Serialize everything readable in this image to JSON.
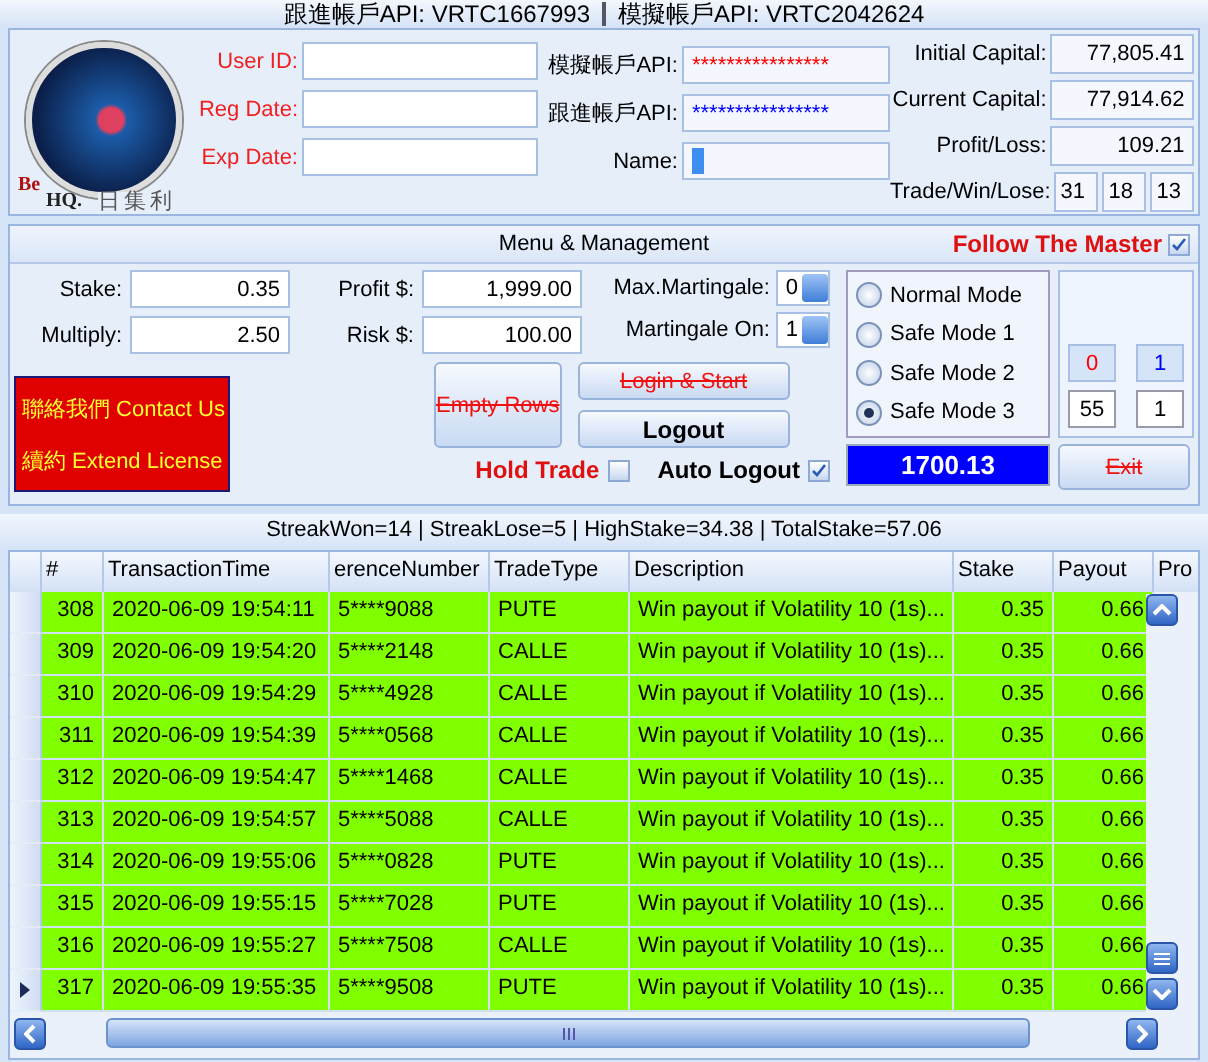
{
  "header": {
    "follow_api": "跟進帳戶API: VRTC1667993",
    "demo_api": "模擬帳戶API: VRTC2042624"
  },
  "logo": {
    "text_1": "Be",
    "text_2": "HQ.",
    "text_3": "日集利"
  },
  "account_fields": [
    {
      "label": "User ID:"
    },
    {
      "label": "Reg Date:"
    },
    {
      "label": "Exp Date:"
    }
  ],
  "api_fields": [
    {
      "label": "模擬帳戶API:",
      "value": "****************",
      "color": "#ff0000"
    },
    {
      "label": "跟進帳戶API:",
      "value": "****************",
      "color": "#0000ff"
    },
    {
      "label": "Name:"
    }
  ],
  "capital": [
    {
      "label": "Initial Capital:",
      "value": "77,805.41"
    },
    {
      "label": "Current Capital:",
      "value": "77,914.62"
    },
    {
      "label": "Profit/Loss:",
      "value": "109.21"
    }
  ],
  "trade_win_lose": {
    "label": "Trade/Win/Lose:",
    "values": [
      "31",
      "18",
      "13"
    ]
  },
  "menu": {
    "title": "Menu & Management",
    "follow": {
      "label": "Follow The Master",
      "checked": true
    }
  },
  "stake": {
    "label": "Stake:",
    "value": "0.35"
  },
  "multiply": {
    "label": "Multiply:",
    "value": "2.50"
  },
  "profit": {
    "label": "Profit $:",
    "value": "1,999.00"
  },
  "risk": {
    "label": "Risk $:",
    "value": "100.00"
  },
  "max_martingale": {
    "label": "Max.Martingale:",
    "value": "0"
  },
  "martingale_on": {
    "label": "Martingale On:",
    "value": "1"
  },
  "modes": [
    {
      "label": "Normal Mode",
      "selected": false
    },
    {
      "label": "Safe Mode 1",
      "selected": false
    },
    {
      "label": "Safe Mode 2",
      "selected": false
    },
    {
      "label": "Safe Mode 3",
      "selected": true
    }
  ],
  "counters": [
    {
      "kind": "indicator",
      "value": "0",
      "color": "#ff0000"
    },
    {
      "kind": "indicator",
      "value": "1",
      "color": "#0000ff"
    },
    {
      "kind": "input",
      "value": "55"
    },
    {
      "kind": "input",
      "value": "1"
    }
  ],
  "contact": [
    "聯絡我們 Contact Us",
    "續約 Extend License"
  ],
  "buttons": {
    "empty_rows": {
      "label": "Empty Rows",
      "disabled": true
    },
    "login": {
      "label": "Login & Start",
      "disabled": true
    },
    "logout": {
      "label": "Logout",
      "disabled": false
    },
    "exit": {
      "label": "Exit",
      "disabled": true
    }
  },
  "hold_trade": {
    "label": "Hold Trade",
    "checked": false
  },
  "auto_logout": {
    "label": "Auto Logout",
    "checked": true
  },
  "balance": "1700.13",
  "stats": "StreakWon=14 | StreakLose=5 | HighStake=34.38 | TotalStake=57.06",
  "table": {
    "columns": [
      "#",
      "TransactionTime",
      "erenceNumber",
      "TradeType",
      "Description",
      "Stake",
      "Payout",
      "Pro"
    ],
    "rows": [
      {
        "cells": [
          "308",
          "2020-06-09 19:54:11",
          "5****9088",
          "PUTE",
          "Win payout if Volatility 10 (1s)...",
          "0.35",
          "0.66"
        ],
        "selected": false
      },
      {
        "cells": [
          "309",
          "2020-06-09 19:54:20",
          "5****2148",
          "CALLE",
          "Win payout if Volatility 10 (1s)...",
          "0.35",
          "0.66"
        ],
        "selected": false
      },
      {
        "cells": [
          "310",
          "2020-06-09 19:54:29",
          "5****4928",
          "CALLE",
          "Win payout if Volatility 10 (1s)...",
          "0.35",
          "0.66"
        ],
        "selected": false
      },
      {
        "cells": [
          "311",
          "2020-06-09 19:54:39",
          "5****0568",
          "CALLE",
          "Win payout if Volatility 10 (1s)...",
          "0.35",
          "0.66"
        ],
        "selected": false
      },
      {
        "cells": [
          "312",
          "2020-06-09 19:54:47",
          "5****1468",
          "CALLE",
          "Win payout if Volatility 10 (1s)...",
          "0.35",
          "0.66"
        ],
        "selected": false
      },
      {
        "cells": [
          "313",
          "2020-06-09 19:54:57",
          "5****5088",
          "CALLE",
          "Win payout if Volatility 10 (1s)...",
          "0.35",
          "0.66"
        ],
        "selected": false
      },
      {
        "cells": [
          "314",
          "2020-06-09 19:55:06",
          "5****0828",
          "PUTE",
          "Win payout if Volatility 10 (1s)...",
          "0.35",
          "0.66"
        ],
        "selected": false
      },
      {
        "cells": [
          "315",
          "2020-06-09 19:55:15",
          "5****7028",
          "PUTE",
          "Win payout if Volatility 10 (1s)...",
          "0.35",
          "0.66"
        ],
        "selected": false
      },
      {
        "cells": [
          "316",
          "2020-06-09 19:55:27",
          "5****7508",
          "CALLE",
          "Win payout if Volatility 10 (1s)...",
          "0.35",
          "0.66"
        ],
        "selected": false
      },
      {
        "cells": [
          "317",
          "2020-06-09 19:55:35",
          "5****9508",
          "PUTE",
          "Win payout if Volatility 10 (1s)...",
          "0.35",
          "0.66"
        ],
        "selected": true
      }
    ]
  }
}
